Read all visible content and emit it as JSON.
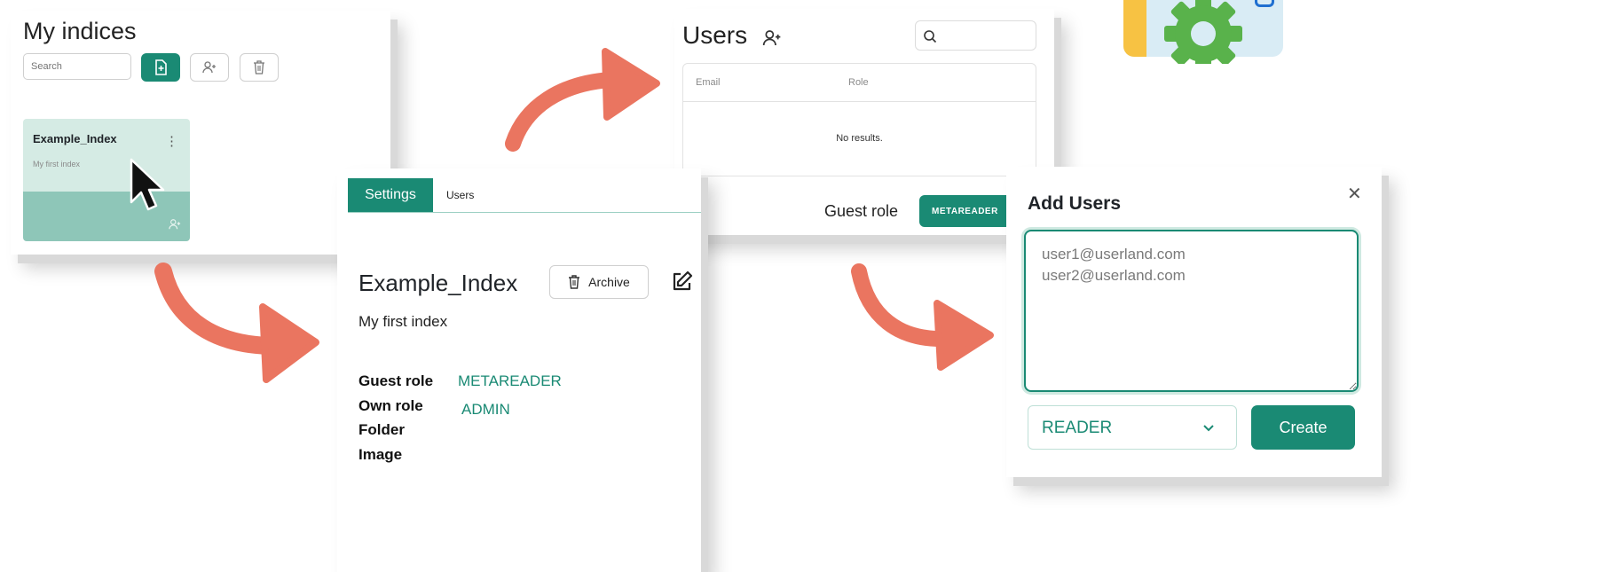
{
  "indices_panel": {
    "title": "My indices",
    "search_placeholder": "Search",
    "card": {
      "name": "Example_Index",
      "description": "My first index",
      "menu_glyph": "⋮"
    }
  },
  "users_panel": {
    "title": "Users",
    "table": {
      "headers": [
        "Email",
        "Role"
      ],
      "empty_text": "No results."
    },
    "guest_role_label": "Guest role",
    "guest_role_value": "METAREADER"
  },
  "settings_panel": {
    "tabs": [
      {
        "label": "Settings",
        "active": true
      },
      {
        "label": "Users",
        "active": false
      }
    ],
    "index_name": "Example_Index",
    "archive_label": "Archive",
    "description": "My first index",
    "fields": [
      {
        "label": "Guest role",
        "value": "METAREADER"
      },
      {
        "label": "Own role",
        "value": "ADMIN"
      },
      {
        "label": "Folder",
        "value": ""
      },
      {
        "label": "Image",
        "value": ""
      }
    ]
  },
  "add_users_panel": {
    "title": "Add Users",
    "textarea_value": "user1@userland.com\nuser2@userland.com",
    "role_select": "READER",
    "create_label": "Create"
  },
  "colors": {
    "accent": "#1a8a74",
    "arrow": "#ea7560",
    "card_light": "#d5ebe4",
    "card_dark": "#8ec6b8"
  }
}
